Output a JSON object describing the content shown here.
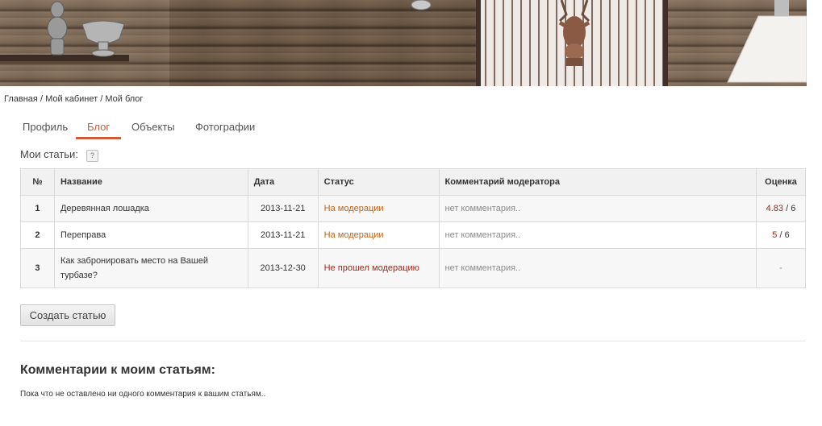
{
  "breadcrumb": {
    "home": "Главная",
    "cabinet": "Мой кабинет",
    "current": "Мой блог",
    "separator": "/"
  },
  "tabs": [
    {
      "label": "Профиль",
      "active": false
    },
    {
      "label": "Блог",
      "active": true
    },
    {
      "label": "Объекты",
      "active": false
    },
    {
      "label": "Фотографии",
      "active": false
    }
  ],
  "my_articles": {
    "label": "Мои статьи:",
    "help_icon": "question-icon",
    "help_glyph": "?"
  },
  "table": {
    "headers": {
      "num": "№",
      "title": "Название",
      "date": "Дата",
      "status": "Статус",
      "comment": "Комментарий модератора",
      "score": "Оценка"
    },
    "rows": [
      {
        "num": "1",
        "title": "Деревянная лошадка",
        "date": "2013-11-21",
        "status": "На модерации",
        "comment": "нет комментария..",
        "score_value": "4.83",
        "score_max": " / 6"
      },
      {
        "num": "2",
        "title": "Переправа",
        "date": "2013-11-21",
        "status": "На модерации",
        "comment": "нет комментария..",
        "score_value": "5",
        "score_max": " / 6"
      },
      {
        "num": "3",
        "title": "Как забронировать место на Вашей турбазе?",
        "date": "2013-12-30",
        "status": "Не прошел модерацию",
        "comment": "нет комментария..",
        "score_value": "",
        "score_max": "-"
      }
    ]
  },
  "create_button": "Создать статью",
  "comments": {
    "title": "Комментарии к моим статьям:",
    "empty_text": "Пока что не оставлено ни одного комментария к вашим статьям.."
  },
  "colors": {
    "accent": "#d05a3a",
    "status_pending": "#c0641e",
    "status_rejected": "#9a2b1c"
  }
}
